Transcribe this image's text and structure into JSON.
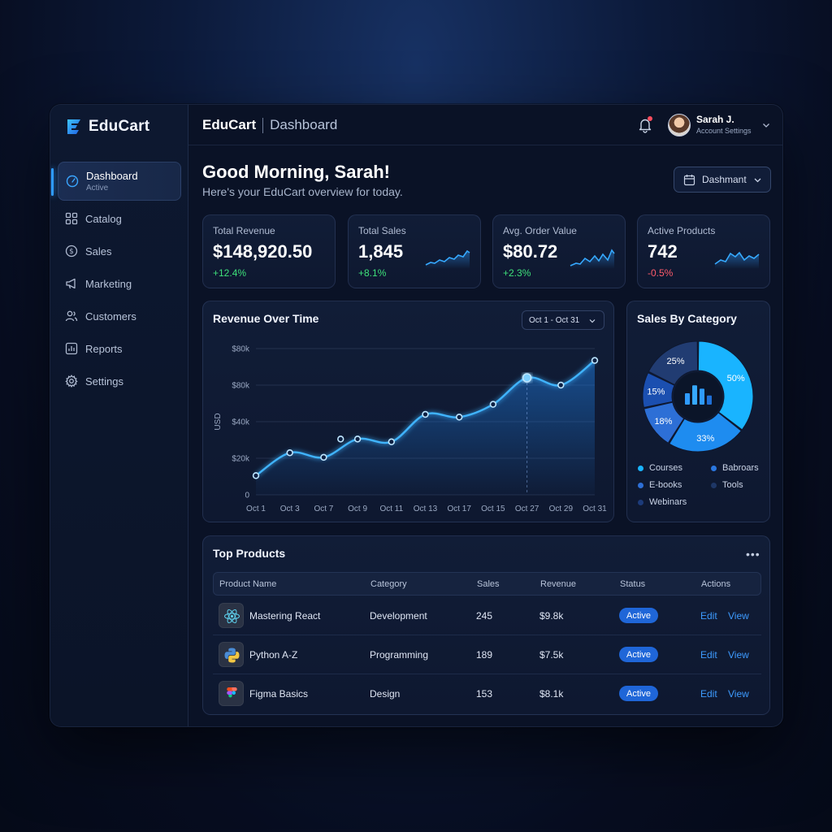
{
  "app": {
    "name": "EduCart"
  },
  "sidebar": {
    "items": [
      {
        "label": "Dashboard",
        "sublabel": "Active",
        "icon": "gauge-icon"
      },
      {
        "label": "Catalog",
        "icon": "grid-icon"
      },
      {
        "label": "Sales",
        "icon": "dollar-circle-icon"
      },
      {
        "label": "Marketing",
        "icon": "megaphone-icon"
      },
      {
        "label": "Customers",
        "icon": "users-icon"
      },
      {
        "label": "Reports",
        "icon": "bar-chart-icon"
      },
      {
        "label": "Settings",
        "icon": "gear-icon"
      }
    ]
  },
  "topbar": {
    "app_name": "EduCart",
    "page_name": "Dashboard",
    "user_name": "Sarah J.",
    "user_sub": "Account Settings"
  },
  "header": {
    "greeting": "Good Morning, Sarah!",
    "subtitle": "Here's your EduCart overview for today.",
    "dropdown_label": "Dashmant"
  },
  "kpis": [
    {
      "label": "Total Revenue",
      "value": "$148,920.50",
      "delta": "+12.4%",
      "trend": "up"
    },
    {
      "label": "Total Sales",
      "value": "1,845",
      "delta": "+8.1%",
      "trend": "up"
    },
    {
      "label": "Avg. Order Value",
      "value": "$80.72",
      "delta": "+2.3%",
      "trend": "up"
    },
    {
      "label": "Active Products",
      "value": "742",
      "delta": "-0.5%",
      "trend": "down"
    }
  ],
  "revenue_card": {
    "title": "Revenue Over Time",
    "range": "Oct 1 - Oct 31"
  },
  "category_card": {
    "title": "Sales By Category",
    "legend": [
      "Courses",
      "Babroars",
      "E-books",
      "Tools",
      "Webinars"
    ]
  },
  "colors": {
    "accent": "#2f9bff",
    "positive": "#3ee07a",
    "negative": "#ff5b6b",
    "badge": "#1f66d8"
  },
  "top_products": {
    "title": "Top Products",
    "columns": [
      "Product Name",
      "Category",
      "Sales",
      "Revenue",
      "Status",
      "Actions"
    ],
    "rows": [
      {
        "name": "Mastering React",
        "category": "Development",
        "sales": "245",
        "revenue": "$9.8k",
        "status": "Active",
        "icon": "react-icon"
      },
      {
        "name": "Python A-Z",
        "category": "Programming",
        "sales": "189",
        "revenue": "$7.5k",
        "status": "Active",
        "icon": "python-icon"
      },
      {
        "name": "Figma Basics",
        "category": "Design",
        "sales": "153",
        "revenue": "$8.1k",
        "status": "Active",
        "icon": "figma-icon"
      }
    ],
    "action_edit": "Edit",
    "action_view": "View"
  },
  "chart_data": [
    {
      "type": "line",
      "title": "Revenue Over Time",
      "ylabel": "USD",
      "categories": [
        "Oct 1",
        "Oct 3",
        "Oct 7",
        "Oct 9",
        "Oct 11",
        "Oct 13",
        "Oct 17",
        "Oct 15",
        "Oct 27",
        "Oct 29",
        "Oct 31"
      ],
      "x": [
        0,
        1,
        2,
        3,
        4,
        5,
        6,
        7,
        8,
        9,
        10
      ],
      "y": [
        10500,
        23000,
        20500,
        30500,
        29000,
        44000,
        42500,
        49500,
        64000,
        60000,
        73500
      ],
      "extra_points": [
        {
          "x": 2.5,
          "y": 30500
        }
      ],
      "highlight_index": 8,
      "ylim": [
        0,
        80000
      ],
      "yticks": [
        {
          "value": 0,
          "label": "0"
        },
        {
          "value": 20000,
          "label": "$20k"
        },
        {
          "value": 40000,
          "label": "$40k"
        },
        {
          "value": 60000,
          "label": "$80k"
        },
        {
          "value": 80000,
          "label": "$80k"
        }
      ],
      "grid": true
    },
    {
      "type": "pie",
      "title": "Sales By Category",
      "donut": true,
      "slices": [
        {
          "label": "50%",
          "value": 50,
          "color": "#19b4ff"
        },
        {
          "label": "33%",
          "value": 33,
          "color": "#1e8cf0"
        },
        {
          "label": "18%",
          "value": 18,
          "color": "#2d6fd6"
        },
        {
          "label": "15%",
          "value": 15,
          "color": "#1b4fb0"
        },
        {
          "label": "25%",
          "value": 25,
          "color": "#213c72"
        }
      ],
      "legend": [
        {
          "label": "Courses",
          "color": "#19b4ff"
        },
        {
          "label": "Babroars",
          "color": "#2a77e0"
        },
        {
          "label": "E-books",
          "color": "#2d6fd6"
        },
        {
          "label": "Tools",
          "color": "#1e3766"
        },
        {
          "label": "Webinars",
          "color": "#1c3b7a"
        }
      ]
    }
  ]
}
